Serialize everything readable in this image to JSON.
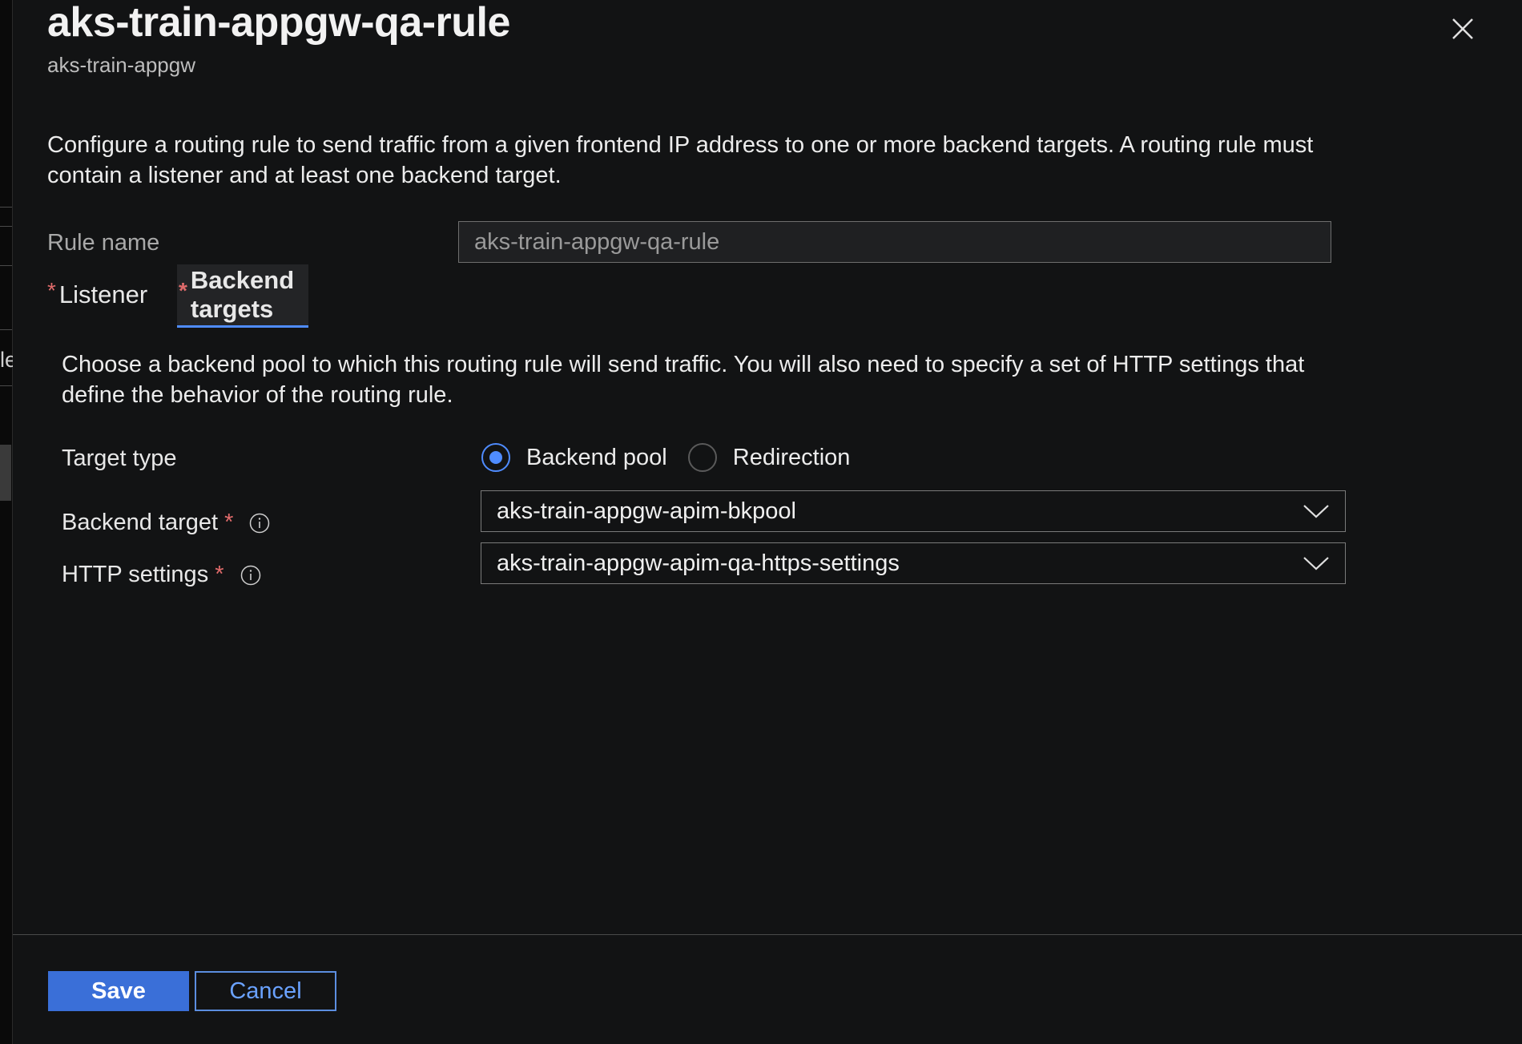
{
  "panel": {
    "title": "aks-train-appgw-qa-rule",
    "subtitle": "aks-train-appgw",
    "description": "Configure a routing rule to send traffic from a given frontend IP address to one or more backend targets. A routing rule must contain a listener and at least one backend target."
  },
  "left_fragment": "le",
  "rule_name": {
    "label": "Rule name",
    "value": "aks-train-appgw-qa-rule"
  },
  "tabs": [
    {
      "label": "Listener",
      "required_marker": "*",
      "active": false
    },
    {
      "label": "Backend targets",
      "required_marker": "*",
      "active": true
    }
  ],
  "backend_section": {
    "description": "Choose a backend pool to which this routing rule will send traffic. You will also need to specify a set of HTTP settings that define the behavior of the routing rule.",
    "target_type": {
      "label": "Target type",
      "options": [
        {
          "label": "Backend pool",
          "selected": true
        },
        {
          "label": "Redirection",
          "selected": false
        }
      ]
    },
    "backend_target": {
      "label": "Backend target",
      "required_marker": "*",
      "value": "aks-train-appgw-apim-bkpool"
    },
    "http_settings": {
      "label": "HTTP settings",
      "required_marker": "*",
      "value": "aks-train-appgw-apim-qa-https-settings"
    }
  },
  "footer": {
    "save_label": "Save",
    "cancel_label": "Cancel"
  },
  "colors": {
    "background": "#121314",
    "accent": "#4f8cff",
    "primary_button": "#3a6fd8",
    "required": "#e06b6b"
  },
  "icons": {
    "close": "close-icon",
    "info": "info-icon",
    "dropdown": "chevron-down-icon"
  }
}
